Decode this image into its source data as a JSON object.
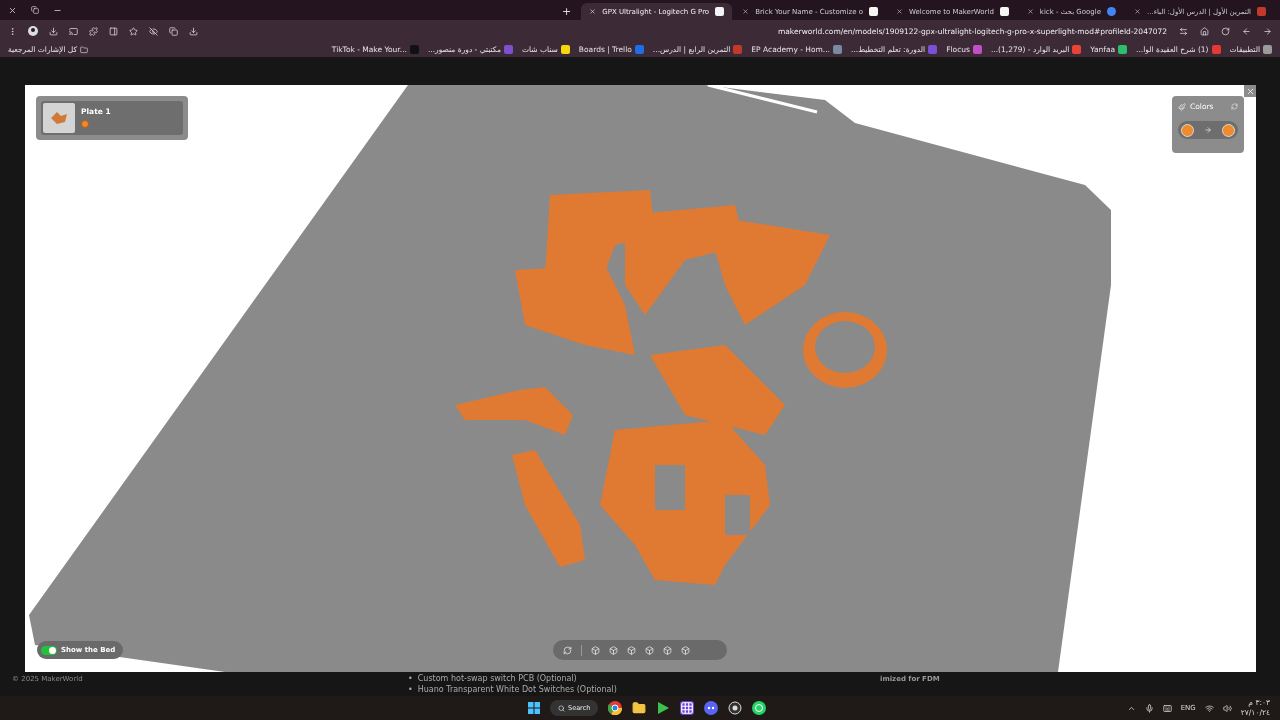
{
  "browser": {
    "tabs": [
      {
        "title": "التمرين الأول | الدرس الأول: الباء...",
        "selected": false,
        "kind": "flag"
      },
      {
        "title": "kick - بحث Google",
        "selected": false,
        "kind": "google"
      },
      {
        "title": "Welcome to MakerWorld",
        "selected": false,
        "kind": "maker"
      },
      {
        "title": "Brick Your Name - Customize o",
        "selected": false,
        "kind": "maker"
      },
      {
        "title": "GPX Ultralight - Logitech G Pro",
        "selected": true,
        "kind": "maker"
      }
    ],
    "new_tab": "+",
    "url": "makerworld.com/en/models/1909122-gpx-ultralight-logitech-g-pro-x-superlight-mod#profileId-2047072",
    "bookmarks": [
      {
        "label": "التطبيقات",
        "color": "#9a9a9a"
      },
      {
        "label": "(1) شرح العقيدة الوا...",
        "color": "#e53935"
      },
      {
        "label": "Yanfaa",
        "color": "#2bbf6a"
      },
      {
        "label": "البريد الوارد - (1,279)...",
        "color": "#ea4335"
      },
      {
        "label": "Flocus",
        "color": "#c04fc8"
      },
      {
        "label": "الدورة: تعلم التخطيط...",
        "color": "#7b4fd8"
      },
      {
        "label": "EP Academy - Hom...",
        "color": "#7a8aa0"
      },
      {
        "label": "التمرين الرابع | الدرس...",
        "color": "#c0392b"
      },
      {
        "label": "Boards | Trello",
        "color": "#1e6ee8"
      },
      {
        "label": "سناب شات",
        "color": "#f5d90a"
      },
      {
        "label": "مكتبتي - دورة منصور...",
        "color": "#7e4fd0"
      },
      {
        "label": "TikTok - Make Your...",
        "color": "#111111"
      }
    ],
    "all_bookmarks": "كل الإشارات المرجعية"
  },
  "viewer": {
    "plate": {
      "label": "Plate 1"
    },
    "colors_panel": {
      "title": "Colors"
    },
    "show_bed": {
      "label": "Show the Bed",
      "on": true
    }
  },
  "background_page": {
    "copyright": "© 2025 MakerWorld",
    "list_items": [
      {
        "marker": "•",
        "text": "Custom hot-swap switch PCB (Optional)"
      },
      {
        "marker": "•",
        "text": "Huano Transparent White Dot Switches (Optional)"
      }
    ],
    "fragment": "imized for FDM"
  },
  "taskbar": {
    "search": "Search",
    "language": "ENG",
    "time": "٣:٠٣ م",
    "date": "٢٧/١٠/٢٤"
  }
}
